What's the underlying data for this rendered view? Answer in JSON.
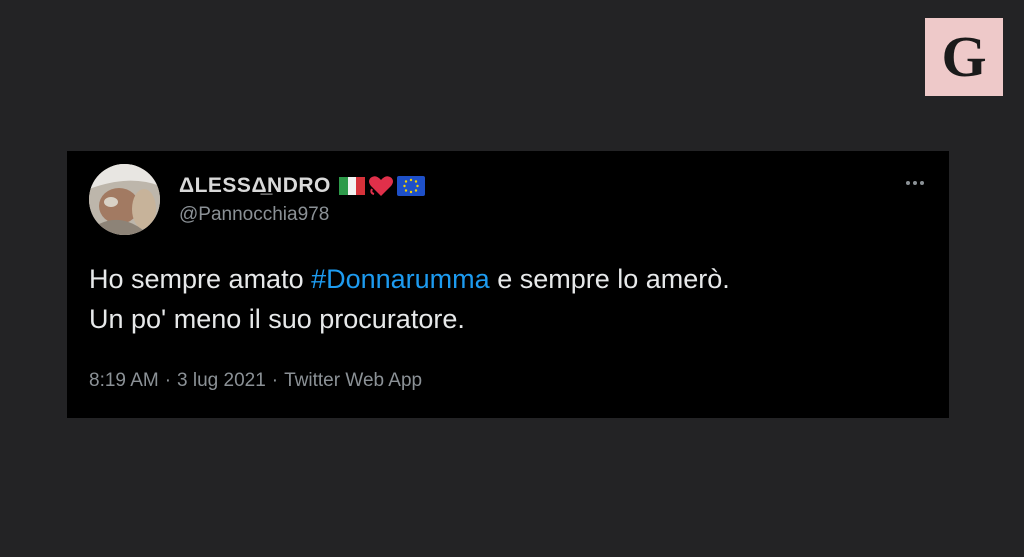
{
  "logo": {
    "letter": "G",
    "color": "#eec9c9"
  },
  "tweet": {
    "avatar_icon": "profile-photo",
    "display_name": "ΔLESSΔ̲NDRO",
    "name_emojis": [
      "flag-italy-icon",
      "heart-icon",
      "flag-eu-icon"
    ],
    "handle": "@Pannocchia978",
    "more_icon": "more-horizontal-icon",
    "text_before": "Ho sempre amato ",
    "hashtag": "#Donnarumma",
    "text_after": " e sempre lo amerò.",
    "text_line2": "Un po' meno il suo procuratore.",
    "time": "8:19 AM",
    "date": "3 lug 2021",
    "separator": "·",
    "source": "Twitter Web App",
    "hashtag_color": "#1d9bf0",
    "background": "#000000"
  }
}
